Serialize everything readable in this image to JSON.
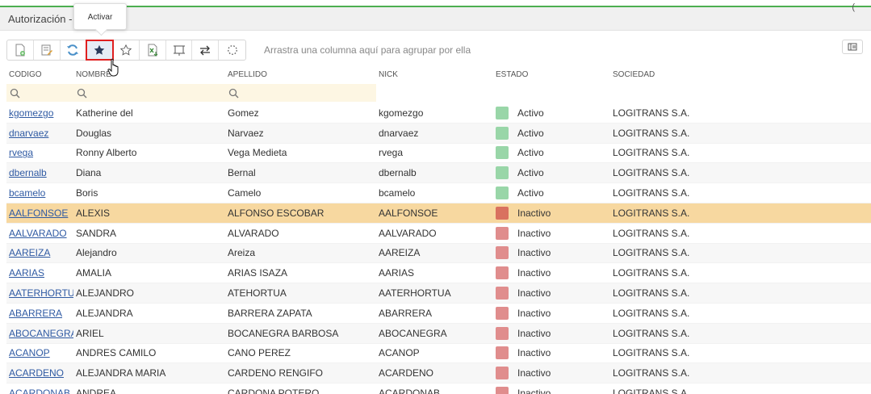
{
  "window": {
    "title": "Autorización -",
    "corner_glyph": "("
  },
  "tooltip": {
    "text": "Activar"
  },
  "toolbar": {
    "group_hint": "Arrastra una columna aquí para agrupar por ella",
    "buttons": [
      {
        "icon": "new-document-icon"
      },
      {
        "icon": "edit-document-icon"
      },
      {
        "icon": "refresh-icon"
      },
      {
        "icon": "star-filled-icon"
      },
      {
        "icon": "star-outline-icon"
      },
      {
        "icon": "excel-export-icon"
      },
      {
        "icon": "columns-chooser-icon"
      },
      {
        "icon": "swap-arrows-icon"
      },
      {
        "icon": "loading-spinner-icon"
      }
    ]
  },
  "columns": [
    "CÓDIGO",
    "NOMBRE",
    "APELLIDO",
    "NICK",
    "ESTADO",
    "SOCIEDAD"
  ],
  "colors": {
    "activo": "#99d6a8",
    "inactivo": "#e08d8d",
    "inactivo_selected": "#d9715f",
    "selected_row": "#f7d8a0",
    "accent": "#4caf50"
  },
  "rows": [
    {
      "code": "kgomezgo",
      "nombre": "Katherine del",
      "apellido": "Gomez",
      "nick": "kgomezgo",
      "estado": "Activo",
      "sociedad": "LOGITRANS S.A."
    },
    {
      "code": "dnarvaez",
      "nombre": "Douglas",
      "apellido": "Narvaez",
      "nick": "dnarvaez",
      "estado": "Activo",
      "sociedad": "LOGITRANS S.A."
    },
    {
      "code": "rvega",
      "nombre": "Ronny Alberto",
      "apellido": "Vega Medieta",
      "nick": "rvega",
      "estado": "Activo",
      "sociedad": "LOGITRANS S.A."
    },
    {
      "code": "dbernalb",
      "nombre": "Diana",
      "apellido": "Bernal",
      "nick": "dbernalb",
      "estado": "Activo",
      "sociedad": "LOGITRANS S.A."
    },
    {
      "code": "bcamelo",
      "nombre": "Boris",
      "apellido": "Camelo",
      "nick": "bcamelo",
      "estado": "Activo",
      "sociedad": "LOGITRANS S.A."
    },
    {
      "code": "AALFONSOE",
      "nombre": "ALEXIS",
      "apellido": "ALFONSO ESCOBAR",
      "nick": "AALFONSOE",
      "estado": "Inactivo",
      "sociedad": "LOGITRANS S.A.",
      "selected": true
    },
    {
      "code": "AALVARADO",
      "nombre": "SANDRA",
      "apellido": "ALVARADO",
      "nick": "AALVARADO",
      "estado": "Inactivo",
      "sociedad": "LOGITRANS S.A."
    },
    {
      "code": "AAREIZA",
      "nombre": "Alejandro",
      "apellido": "Areiza",
      "nick": "AAREIZA",
      "estado": "Inactivo",
      "sociedad": "LOGITRANS S.A."
    },
    {
      "code": "AARIAS",
      "nombre": "AMALIA",
      "apellido": "ARIAS ISAZA",
      "nick": "AARIAS",
      "estado": "Inactivo",
      "sociedad": "LOGITRANS S.A."
    },
    {
      "code": "AATERHORTUA",
      "nombre": "ALEJANDRO",
      "apellido": "ATEHORTUA",
      "nick": "AATERHORTUA",
      "estado": "Inactivo",
      "sociedad": "LOGITRANS S.A."
    },
    {
      "code": "ABARRERA",
      "nombre": "ALEJANDRA",
      "apellido": "BARRERA ZAPATA",
      "nick": "ABARRERA",
      "estado": "Inactivo",
      "sociedad": "LOGITRANS S.A."
    },
    {
      "code": "ABOCANEGRA",
      "nombre": "ARIEL",
      "apellido": "BOCANEGRA BARBOSA",
      "nick": "ABOCANEGRA",
      "estado": "Inactivo",
      "sociedad": "LOGITRANS S.A."
    },
    {
      "code": "ACANOP",
      "nombre": "ANDRES CAMILO",
      "apellido": "CANO PEREZ",
      "nick": "ACANOP",
      "estado": "Inactivo",
      "sociedad": "LOGITRANS S.A."
    },
    {
      "code": "ACARDENO",
      "nombre": "ALEJANDRA MARIA",
      "apellido": "CARDENO RENGIFO",
      "nick": "ACARDENO",
      "estado": "Inactivo",
      "sociedad": "LOGITRANS S.A."
    },
    {
      "code": "ACARDONAB",
      "nombre": "ANDREA",
      "apellido": "CARDONA POTERO",
      "nick": "ACARDONAB",
      "estado": "Inactivo",
      "sociedad": "LOGITRANS S.A."
    }
  ]
}
